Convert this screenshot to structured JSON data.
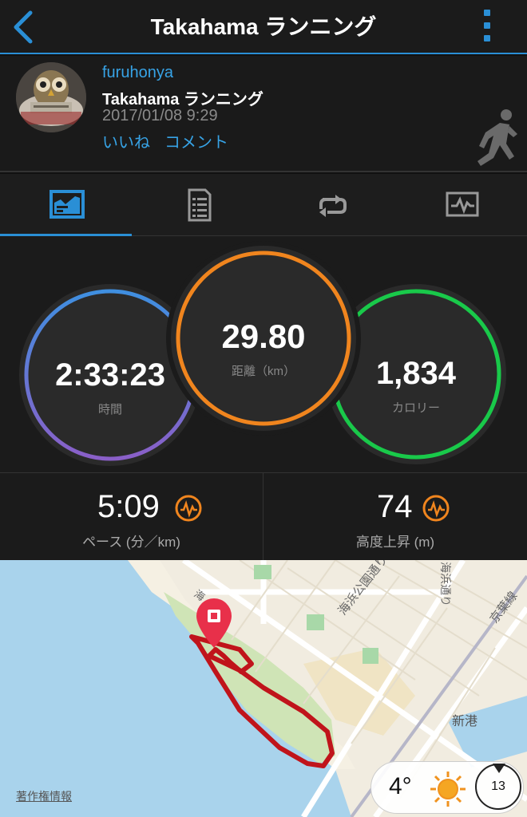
{
  "header": {
    "title": "Takahama ランニング"
  },
  "activity": {
    "username": "furuhonya",
    "name": "Takahama ランニング",
    "date": "2017/01/08 9:29",
    "like": "いいね",
    "comment": "コメント"
  },
  "stats": {
    "time": {
      "value": "2:33:23",
      "label": "時間"
    },
    "distance": {
      "value": "29.80",
      "label": "距離（km）"
    },
    "calories": {
      "value": "1,834",
      "label": "カロリー"
    },
    "pace": {
      "value": "5:09",
      "label": "ペース (分／km)"
    },
    "elevation": {
      "value": "74",
      "label": "高度上昇 (m)"
    }
  },
  "map": {
    "labels": {
      "street1": "海浜公園通り",
      "street2": "京葉線",
      "street3": "海浜通り",
      "district": "新港",
      "road_top": "海"
    },
    "copyright": "著作権情報",
    "weather": {
      "temp": "4°",
      "wind": "13"
    }
  },
  "colors": {
    "accent": "#2a8fd6",
    "time_ring": "#6a7cd8",
    "distance_ring": "#f0851e",
    "calorie_ring": "#19c94a",
    "route": "#c0141b"
  }
}
